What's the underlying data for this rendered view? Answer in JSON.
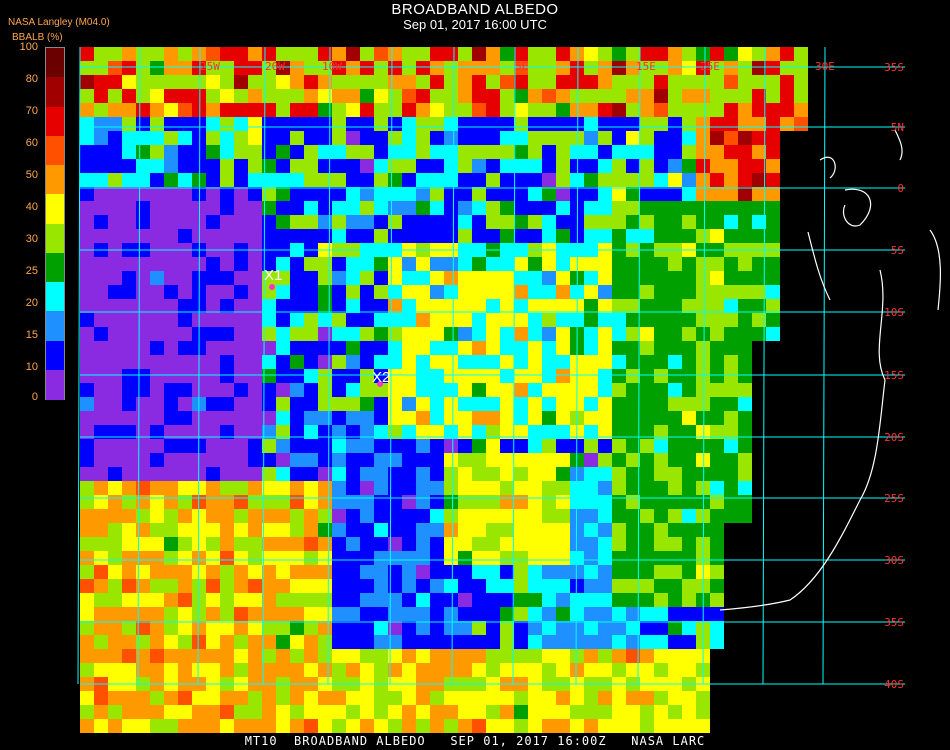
{
  "title": "BROADBAND ALBEDO",
  "subtitle": "Sep 01, 2017 16:00 UTC",
  "provider": "NASA Langley (M04.0)",
  "colorbar": {
    "label": "BBALB (%)",
    "ticks": [
      "100",
      "80",
      "70",
      "60",
      "50",
      "40",
      "30",
      "25",
      "20",
      "15",
      "10",
      "0"
    ],
    "colors": [
      "#6a0000",
      "#a00000",
      "#e60000",
      "#ff5000",
      "#ff9900",
      "#ffff00",
      "#99e600",
      "#00a000",
      "#00ffff",
      "#1e90ff",
      "#0000ff",
      "#8a2be2"
    ]
  },
  "map": {
    "longitude_labels": [
      "25W",
      "20W",
      "10W",
      "5E",
      "15E",
      "25E",
      "30E"
    ],
    "latitude_labels": [
      "35S",
      "5N",
      "0",
      "5S",
      "10S",
      "15S",
      "20S",
      "25S",
      "30S",
      "35S",
      "40S"
    ],
    "grid_color": "#00ffff",
    "coast_color": "#ffffff",
    "markers": [
      {
        "label": "X1",
        "color": "#ff33cc"
      },
      {
        "label": "X2",
        "color": "#ff33cc"
      }
    ]
  },
  "footer": "MT10  BROADBAND ALBEDO   SEP 01, 2017 16:00Z   NASA LARC"
}
